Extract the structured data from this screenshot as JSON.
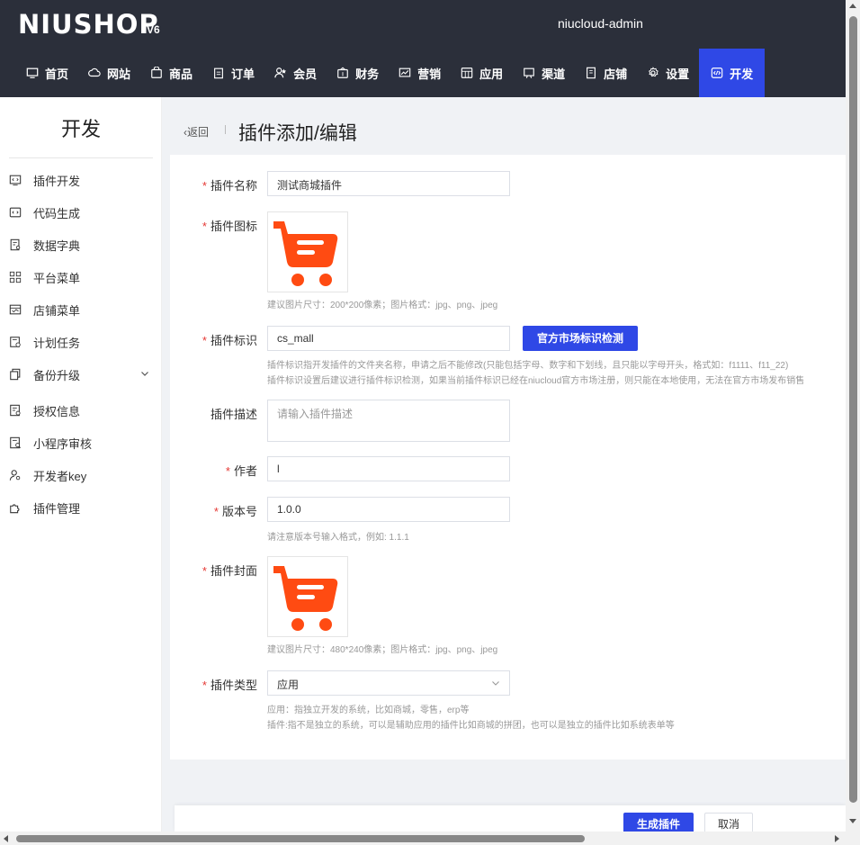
{
  "header": {
    "logo_main": "NIUSHOP",
    "logo_sub": "V6",
    "username": "niucloud-admin",
    "nav": [
      {
        "label": "首页",
        "icon": "monitor-icon"
      },
      {
        "label": "网站",
        "icon": "cloud-icon"
      },
      {
        "label": "商品",
        "icon": "shopping-bag-icon"
      },
      {
        "label": "订单",
        "icon": "clipboard-icon"
      },
      {
        "label": "会员",
        "icon": "user-star-icon"
      },
      {
        "label": "财务",
        "icon": "wallet-icon"
      },
      {
        "label": "营销",
        "icon": "chart-icon"
      },
      {
        "label": "应用",
        "icon": "grid-icon"
      },
      {
        "label": "渠道",
        "icon": "display-icon"
      },
      {
        "label": "店铺",
        "icon": "store-icon"
      },
      {
        "label": "设置",
        "icon": "gear-icon"
      },
      {
        "label": "开发",
        "icon": "code-icon"
      }
    ]
  },
  "sidebar": {
    "title": "开发",
    "items": [
      {
        "label": "插件开发",
        "icon": "code-window-icon"
      },
      {
        "label": "代码生成",
        "icon": "code-file-icon"
      },
      {
        "label": "数据字典",
        "icon": "dictionary-icon"
      },
      {
        "label": "平台菜单",
        "icon": "menu-grid-icon"
      },
      {
        "label": "店铺菜单",
        "icon": "store-menu-icon"
      },
      {
        "label": "计划任务",
        "icon": "schedule-icon"
      },
      {
        "label": "备份升级",
        "icon": "copy-icon"
      },
      {
        "label": "授权信息",
        "icon": "license-icon"
      },
      {
        "label": "小程序审核",
        "icon": "review-icon"
      },
      {
        "label": "开发者key",
        "icon": "user-key-icon"
      },
      {
        "label": "插件管理",
        "icon": "puzzle-icon"
      }
    ]
  },
  "page": {
    "back_label": "返回",
    "title": "插件添加/编辑"
  },
  "form": {
    "name_label": "插件名称",
    "name_value": "测试商城插件",
    "icon_label": "插件图标",
    "icon_tip": "建议图片尺寸：200*200像素；图片格式：jpg、png、jpeg",
    "key_label": "插件标识",
    "key_value": "cs_mall",
    "key_button": "官方市场标识检测",
    "key_tip1": "插件标识指开发插件的文件夹名称，申请之后不能修改(只能包括字母、数字和下划线，且只能以字母开头，格式如：f1111、f11_22)",
    "key_tip2": "插件标识设置后建议进行插件标识检测，如果当前插件标识已经在niucloud官方市场注册，则只能在本地使用，无法在官方市场发布销售",
    "desc_label": "插件描述",
    "desc_placeholder": "请输入插件描述",
    "author_label": "作者",
    "author_value": "l",
    "version_label": "版本号",
    "version_value": "1.0.0",
    "version_tip": "请注意版本号输入格式，例如: 1.1.1",
    "cover_label": "插件封面",
    "cover_tip": "建议图片尺寸：480*240像素；图片格式：jpg、png、jpeg",
    "type_label": "插件类型",
    "type_value": "应用",
    "type_tip1": "应用：指独立开发的系统，比如商城，零售，erp等",
    "type_tip2": "插件:指不是独立的系统，可以是辅助应用的插件比如商城的拼团，也可以是独立的插件比如系统表单等",
    "required_mark": "*"
  },
  "footer": {
    "submit_label": "生成插件",
    "cancel_label": "取消"
  },
  "colors": {
    "header_bg": "#2b2f3a",
    "accent": "#2f48e6",
    "cart_orange": "#ff4b12"
  }
}
